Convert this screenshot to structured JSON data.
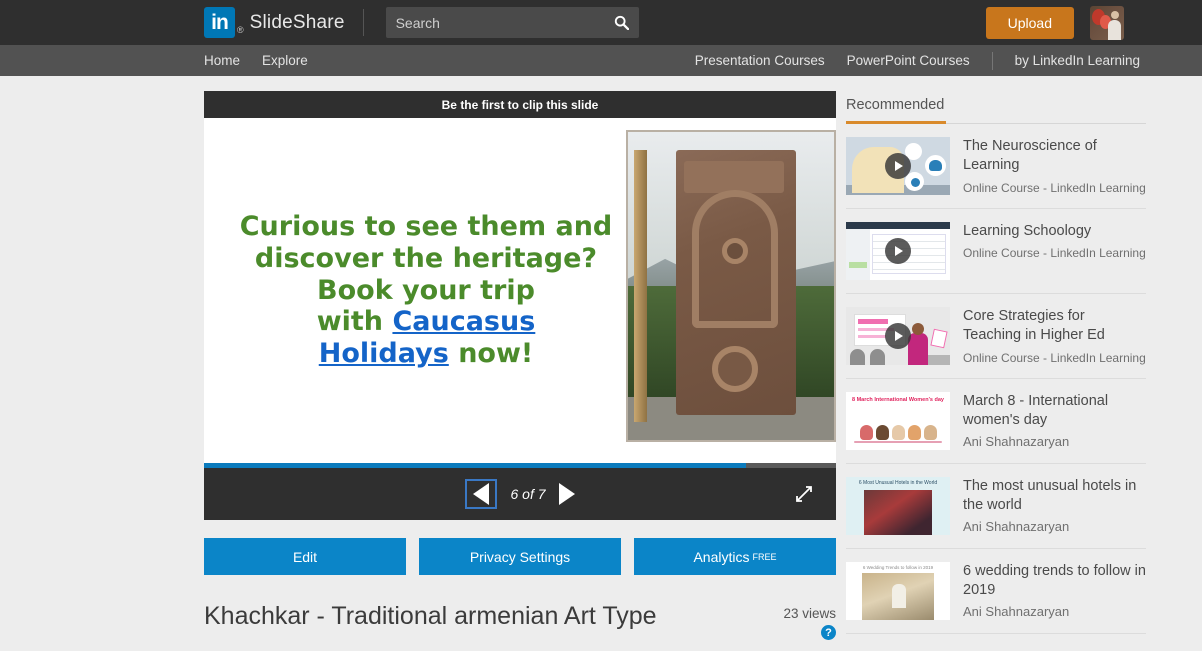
{
  "header": {
    "logo_text": "in",
    "reg_mark": "®",
    "brand": "SlideShare",
    "search_placeholder": "Search",
    "search_value": "",
    "search_icon": "search-icon",
    "upload_label": "Upload",
    "accent_blue": "#0077b5",
    "upload_orange": "#c8761c"
  },
  "nav": {
    "left": [
      {
        "label": "Home"
      },
      {
        "label": "Explore"
      }
    ],
    "right": [
      {
        "label": "Presentation Courses"
      },
      {
        "label": "PowerPoint Courses"
      },
      {
        "label": "by LinkedIn Learning"
      }
    ]
  },
  "player": {
    "clip_banner": "Be the first to clip this slide",
    "slide_counter": "6 of 7",
    "current_slide": 6,
    "total_slides": 7,
    "progress_percent": 85.7,
    "prev_label": "Previous slide",
    "next_label": "Next slide",
    "fullscreen_label": "Fullscreen",
    "progress_color": "#0b7bbd"
  },
  "slide": {
    "line1": "Curious to see them and",
    "line2": "discover the heritage?",
    "line3": "Book your trip",
    "line4_prefix": "with ",
    "link1": "Caucasus",
    "link2": "Holidays",
    "line5_suffix": " now!",
    "text_color": "#4b8b2b",
    "link_color": "#1464c8",
    "photo_alt": "Armenian khachkar carved cross-stone"
  },
  "actions": [
    {
      "label": "Edit",
      "badge": ""
    },
    {
      "label": "Privacy Settings",
      "badge": ""
    },
    {
      "label": "Analytics",
      "badge": "FREE"
    }
  ],
  "deck": {
    "title": "Khachkar - Traditional armenian Art Type",
    "views": "23 views",
    "help_icon": "?"
  },
  "sidebar": {
    "tab_label": "Recommended",
    "tab_accent": "#d98a2b",
    "items": [
      {
        "title": "The Neuroscience of Learning",
        "subtitle": "Online Course - LinkedIn Learning",
        "has_play": true,
        "thumb": "t1"
      },
      {
        "title": "Learning Schoology",
        "subtitle": "Online Course - LinkedIn Learning",
        "has_play": true,
        "thumb": "t2"
      },
      {
        "title": "Core Strategies for Teaching in Higher Ed",
        "subtitle": "Online Course - LinkedIn Learning",
        "has_play": true,
        "thumb": "t3"
      },
      {
        "title": "March 8 - International women's day",
        "subtitle": "Ani Shahnazaryan",
        "has_play": false,
        "thumb": "t4",
        "thumb_caption": "8 March International Women's day"
      },
      {
        "title": "The most unusual hotels in the world",
        "subtitle": "Ani Shahnazaryan",
        "has_play": false,
        "thumb": "t5",
        "thumb_caption": "6 Most Unusual Hotels in the World"
      },
      {
        "title": "6 wedding trends to follow in 2019",
        "subtitle": "Ani Shahnazaryan",
        "has_play": false,
        "thumb": "t6",
        "thumb_caption": "6 Wedding Trends to follow in 2019"
      }
    ]
  }
}
